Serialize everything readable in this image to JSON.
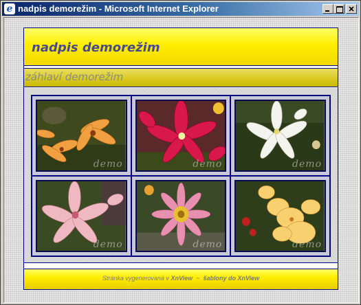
{
  "window": {
    "title": "nadpis demorežim - Microsoft Internet Explorer",
    "app_icon": "internet-explorer-icon"
  },
  "page": {
    "site_title": "nadpis demorežim",
    "header_subtitle": "záhlaví demorežim",
    "gallery": [
      {
        "name": "orange-lily",
        "watermark": "demo"
      },
      {
        "name": "red-lily",
        "watermark": "demo"
      },
      {
        "name": "white-lily",
        "watermark": "demo"
      },
      {
        "name": "pink-lily",
        "watermark": "demo"
      },
      {
        "name": "pink-gazania",
        "watermark": "demo"
      },
      {
        "name": "yellow-gladiolus",
        "watermark": "demo"
      }
    ],
    "footer": {
      "prefix": "Stránka vygenerovaná v",
      "app_link": "XnView",
      "separator": "~",
      "templates_link": "šablony do XnView"
    }
  },
  "colors": {
    "accent": "#000080",
    "header_yellow": "#ffee00",
    "title_text": "#4a4a8a"
  }
}
